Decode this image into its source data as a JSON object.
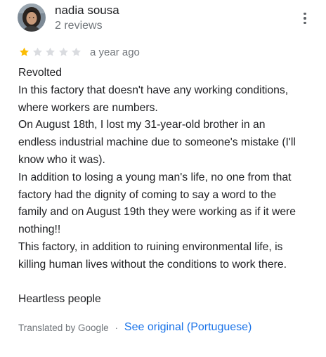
{
  "author": {
    "name": "nadia sousa",
    "review_count": "2 reviews",
    "avatar_icon": "profile-photo"
  },
  "menu": {
    "icon": "more-vert-icon"
  },
  "rating": {
    "value": 1,
    "max": 5,
    "filled_color": "#fbbc04",
    "empty_color": "#dadce0"
  },
  "time": "a year ago",
  "review": {
    "lines": [
      "Revolted",
      "In this factory that doesn't have any working conditions,",
      "where workers are numbers.",
      "On August 18th, I lost my 31-year-old brother in an",
      "endless industrial machine due to someone's mistake (I'll",
      "know who it was).",
      "In addition to losing a young man's life, no one from that",
      "factory had the dignity of coming to say a word to the",
      "family and on August 19th they were working as if it were",
      "nothing!!",
      "This factory, in addition to ruining environmental life, is",
      "killing human lives without the conditions to work there.",
      "",
      "Heartless people"
    ]
  },
  "translation": {
    "translated_by": "Translated by Google",
    "separator": "·",
    "see_original": "See original (Portuguese)",
    "link_color": "#1a73e8"
  }
}
